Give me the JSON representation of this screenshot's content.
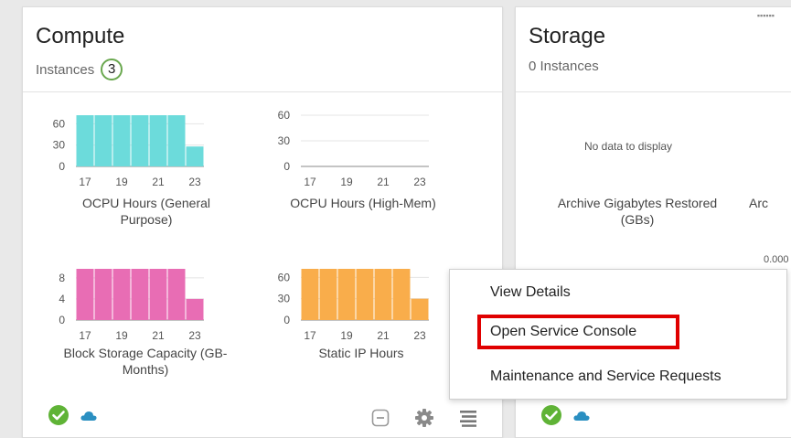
{
  "compute": {
    "title": "Compute",
    "subtitle": "Instances",
    "instance_count": "3",
    "footer_icons": [
      "check-circle-icon",
      "cloud-icon",
      "minus-square-icon",
      "gear-icon",
      "hamburger-menu-icon"
    ]
  },
  "storage": {
    "title": "Storage",
    "subtitle": "0 Instances",
    "no_data": "No data to display",
    "chart1_title": "Archive Gigabytes Restored (GBs)",
    "chart2_title_partial": "Arc",
    "partial_tick": "0.000",
    "footer_icons": [
      "check-circle-icon",
      "cloud-icon"
    ]
  },
  "chart_data": [
    {
      "type": "bar",
      "title": "OCPU Hours (General Purpose)",
      "categories": [
        "17",
        "18",
        "19",
        "20",
        "21",
        "22",
        "23"
      ],
      "x_tick_labels": [
        "17",
        "19",
        "21",
        "23"
      ],
      "y_tick_labels": [
        "0",
        "30",
        "60"
      ],
      "values": [
        72,
        72,
        72,
        72,
        72,
        72,
        28
      ],
      "ylim": [
        0,
        72
      ],
      "color": "#6cdbdb"
    },
    {
      "type": "bar",
      "title": "OCPU Hours (High-Mem)",
      "categories": [
        "17",
        "18",
        "19",
        "20",
        "21",
        "22",
        "23"
      ],
      "x_tick_labels": [
        "17",
        "19",
        "21",
        "23"
      ],
      "y_tick_labels": [
        "0",
        "30",
        "60"
      ],
      "values": [
        0,
        0,
        0,
        0,
        0,
        0,
        0
      ],
      "ylim": [
        0,
        60
      ],
      "color": "#9e9e9e"
    },
    {
      "type": "bar",
      "title": "Block Storage Capacity (GB-Months)",
      "categories": [
        "17",
        "18",
        "19",
        "20",
        "21",
        "22",
        "23"
      ],
      "x_tick_labels": [
        "17",
        "19",
        "21",
        "23"
      ],
      "y_tick_labels": [
        "0",
        "4",
        "8"
      ],
      "values": [
        9.7,
        9.7,
        9.7,
        9.7,
        9.7,
        9.7,
        4
      ],
      "ylim": [
        0,
        9.7
      ],
      "color": "#e86db4"
    },
    {
      "type": "bar",
      "title": "Static IP Hours",
      "categories": [
        "17",
        "18",
        "19",
        "20",
        "21",
        "22",
        "23"
      ],
      "x_tick_labels": [
        "17",
        "19",
        "21",
        "23"
      ],
      "y_tick_labels": [
        "0",
        "30",
        "60"
      ],
      "values": [
        72,
        72,
        72,
        72,
        72,
        72,
        30
      ],
      "ylim": [
        0,
        72
      ],
      "color": "#f9ad4b"
    }
  ],
  "menu": {
    "items": [
      "View Details",
      "Open Service Console",
      "Maintenance and Service Requests"
    ],
    "highlighted": "Open Service Console"
  },
  "colors": {
    "check": "#5fb336",
    "cloud": "#2a8fc1",
    "highlight_border": "#e00000"
  }
}
